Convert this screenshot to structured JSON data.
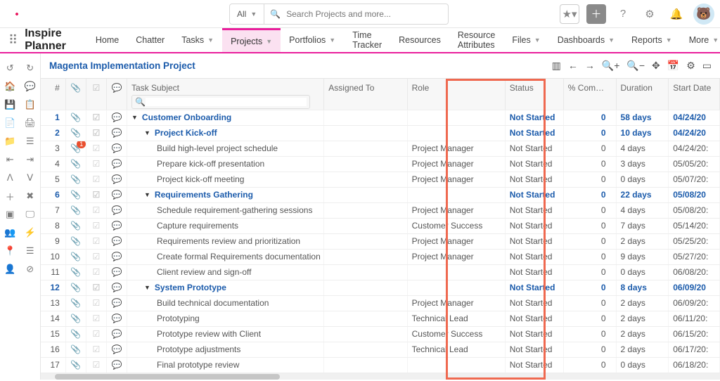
{
  "topbar": {
    "search_all": "All",
    "search_placeholder": "Search Projects and more..."
  },
  "app_name": "Inspire Planner",
  "nav": [
    {
      "label": "Home",
      "chev": false
    },
    {
      "label": "Chatter",
      "chev": false
    },
    {
      "label": "Tasks",
      "chev": true
    },
    {
      "label": "Projects",
      "chev": true,
      "active": true
    },
    {
      "label": "Portfolios",
      "chev": true
    },
    {
      "label": "Time Tracker",
      "chev": false
    },
    {
      "label": "Resources",
      "chev": false
    },
    {
      "label": "Resource Attributes",
      "chev": false
    },
    {
      "label": "Files",
      "chev": true
    },
    {
      "label": "Dashboards",
      "chev": true
    },
    {
      "label": "Reports",
      "chev": true
    },
    {
      "label": "More",
      "chev": true
    }
  ],
  "page_title": "Magenta Implementation Project",
  "columns": {
    "num": "#",
    "attach": "",
    "check": "",
    "chat": "",
    "subject": "Task Subject",
    "assigned": "Assigned To",
    "role": "Role",
    "status": "Status",
    "pct": "% Complete",
    "dur": "Duration",
    "start": "Start Date"
  },
  "rows": [
    {
      "n": "1",
      "section": 1,
      "ind": 1,
      "arrow": true,
      "badge": false,
      "task": "Customer Onboarding",
      "role": "",
      "status": "Not Started",
      "pct": "0",
      "dur": "58 days",
      "date": "04/24/20"
    },
    {
      "n": "2",
      "section": 1,
      "ind": 2,
      "arrow": true,
      "badge": false,
      "task": "Project Kick-off",
      "role": "",
      "status": "Not Started",
      "pct": "0",
      "dur": "10 days",
      "date": "04/24/20"
    },
    {
      "n": "3",
      "section": 0,
      "ind": 3,
      "arrow": false,
      "badge": true,
      "task": "Build high-level project schedule",
      "role": "Project Manager",
      "status": "Not Started",
      "pct": "0",
      "dur": "4 days",
      "date": "04/24/20:"
    },
    {
      "n": "4",
      "section": 0,
      "ind": 3,
      "arrow": false,
      "badge": false,
      "task": "Prepare kick-off presentation",
      "role": "Project Manager",
      "status": "Not Started",
      "pct": "0",
      "dur": "3 days",
      "date": "05/05/20:"
    },
    {
      "n": "5",
      "section": 0,
      "ind": 3,
      "arrow": false,
      "badge": false,
      "task": "Project kick-off meeting",
      "role": "Project Manager",
      "status": "Not Started",
      "pct": "0",
      "dur": "0 days",
      "date": "05/07/20:"
    },
    {
      "n": "6",
      "section": 1,
      "ind": 2,
      "arrow": true,
      "badge": false,
      "task": "Requirements Gathering",
      "role": "",
      "status": "Not Started",
      "pct": "0",
      "dur": "22 days",
      "date": "05/08/20"
    },
    {
      "n": "7",
      "section": 0,
      "ind": 3,
      "arrow": false,
      "badge": false,
      "task": "Schedule requirement-gathering sessions",
      "role": "Project Manager",
      "status": "Not Started",
      "pct": "0",
      "dur": "4 days",
      "date": "05/08/20:"
    },
    {
      "n": "8",
      "section": 0,
      "ind": 3,
      "arrow": false,
      "badge": false,
      "task": "Capture requirements",
      "role": "Customer Success",
      "status": "Not Started",
      "pct": "0",
      "dur": "7 days",
      "date": "05/14/20:"
    },
    {
      "n": "9",
      "section": 0,
      "ind": 3,
      "arrow": false,
      "badge": false,
      "task": "Requirements review and prioritization",
      "role": "Project Manager",
      "status": "Not Started",
      "pct": "0",
      "dur": "2 days",
      "date": "05/25/20:"
    },
    {
      "n": "10",
      "section": 0,
      "ind": 3,
      "arrow": false,
      "badge": false,
      "task": "Create formal Requirements documentation",
      "role": "Project Manager",
      "status": "Not Started",
      "pct": "0",
      "dur": "9 days",
      "date": "05/27/20:"
    },
    {
      "n": "11",
      "section": 0,
      "ind": 3,
      "arrow": false,
      "badge": false,
      "task": "Client review and sign-off",
      "role": "",
      "status": "Not Started",
      "pct": "0",
      "dur": "0 days",
      "date": "06/08/20:"
    },
    {
      "n": "12",
      "section": 1,
      "ind": 2,
      "arrow": true,
      "badge": false,
      "task": "System Prototype",
      "role": "",
      "status": "Not Started",
      "pct": "0",
      "dur": "8 days",
      "date": "06/09/20"
    },
    {
      "n": "13",
      "section": 0,
      "ind": 3,
      "arrow": false,
      "badge": false,
      "task": "Build technical documentation",
      "role": "Project Manager",
      "status": "Not Started",
      "pct": "0",
      "dur": "2 days",
      "date": "06/09/20:"
    },
    {
      "n": "14",
      "section": 0,
      "ind": 3,
      "arrow": false,
      "badge": false,
      "task": "Prototyping",
      "role": "Technical Lead",
      "status": "Not Started",
      "pct": "0",
      "dur": "2 days",
      "date": "06/11/20:"
    },
    {
      "n": "15",
      "section": 0,
      "ind": 3,
      "arrow": false,
      "badge": false,
      "task": "Prototype review with Client",
      "role": "Customer Success",
      "status": "Not Started",
      "pct": "0",
      "dur": "2 days",
      "date": "06/15/20:"
    },
    {
      "n": "16",
      "section": 0,
      "ind": 3,
      "arrow": false,
      "badge": false,
      "task": "Prototype adjustments",
      "role": "Technical Lead",
      "status": "Not Started",
      "pct": "0",
      "dur": "2 days",
      "date": "06/17/20:"
    },
    {
      "n": "17",
      "section": 0,
      "ind": 3,
      "arrow": false,
      "badge": false,
      "task": "Final prototype review",
      "role": "",
      "status": "Not Started",
      "pct": "0",
      "dur": "0 days",
      "date": "06/18/20:"
    }
  ],
  "rail_icons": [
    "↺",
    "↻",
    "🏠",
    "💬",
    "💾",
    "📋",
    "📄",
    "🖨",
    "📁",
    "☰",
    "⇤",
    "⇥",
    "ᐱ",
    "ᐯ",
    "＋",
    "✖",
    "▣",
    "🖵",
    "👥",
    "⚡",
    "📍",
    "☰",
    "👤",
    "⊘"
  ],
  "head_icons": [
    "▥",
    "←",
    "→",
    "🔍+",
    "🔍−",
    "✥",
    "📅",
    "⚙",
    "▭"
  ]
}
